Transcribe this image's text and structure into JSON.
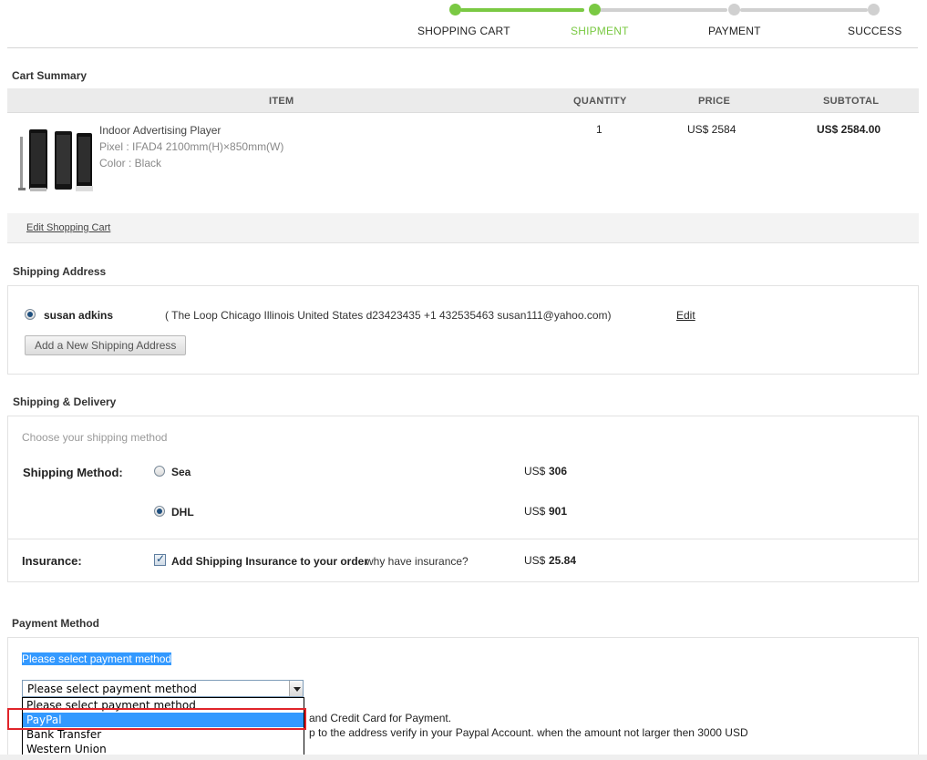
{
  "progress": {
    "steps": [
      {
        "label": "SHOPPING CART",
        "state": "done"
      },
      {
        "label": "SHIPMENT",
        "state": "current"
      },
      {
        "label": "PAYMENT",
        "state": "pending"
      },
      {
        "label": "SUCCESS",
        "state": "pending"
      }
    ],
    "colors": {
      "active": "#7ac943",
      "inactive": "#cccccc",
      "current_label": "#7ac943"
    }
  },
  "cart": {
    "title": "Cart Summary",
    "columns": [
      "ITEM",
      "QUANTITY",
      "PRICE",
      "SUBTOTAL"
    ],
    "item": {
      "name": "Indoor Advertising Player",
      "pixel": "Pixel : IFAD4 2100mm(H)×850mm(W)",
      "color": "Color : Black",
      "quantity": "1",
      "price": "US$ 2584",
      "subtotal": "US$ 2584.00"
    },
    "edit_link": "Edit Shopping Cart"
  },
  "shipping_address": {
    "title": "Shipping Address",
    "name": "susan adkins",
    "details": "( The Loop   Chicago   Illinois   United States d23423435  +1 432535463   susan111@yahoo.com)",
    "edit_label": "Edit",
    "add_button": "Add a New Shipping Address"
  },
  "delivery": {
    "title": "Shipping & Delivery",
    "hint": "Choose your shipping method",
    "method_label": "Shipping Method:",
    "options": [
      {
        "name": "Sea",
        "currency": "US$",
        "amount": "306",
        "selected": false
      },
      {
        "name": "DHL",
        "currency": "US$",
        "amount": "901",
        "selected": true
      }
    ],
    "insurance_label": "Insurance:",
    "insurance_text": "Add Shipping Insurance to your order",
    "insurance_why": "why have insurance?",
    "insurance_currency": "US$",
    "insurance_amount": "25.84",
    "insurance_checked": true
  },
  "payment": {
    "title": "Payment Method",
    "prompt": "Please select payment method",
    "select_value": "Please select payment method",
    "options": [
      "Please select payment method",
      "PayPal",
      "Bank Transfer",
      "Western Union"
    ],
    "selected_index": 1,
    "behind_text_1": "and Credit Card for Payment.",
    "behind_text_2": "p to the address verify in your Paypal Account.  when the amount not larger then 3000 USD"
  }
}
